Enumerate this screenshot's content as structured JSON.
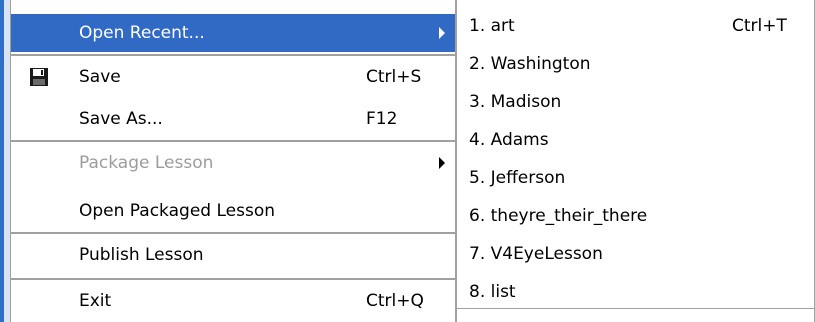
{
  "menu": {
    "open_recent": {
      "label": "Open Recent...",
      "shortcut": ""
    },
    "save": {
      "label": "Save",
      "shortcut": "Ctrl+S",
      "icon": "floppy-disk-icon"
    },
    "save_as": {
      "label": "Save As...",
      "shortcut": "F12"
    },
    "package_lesson": {
      "label": "Package Lesson",
      "shortcut": ""
    },
    "open_packaged_lesson": {
      "label": "Open Packaged Lesson",
      "shortcut": ""
    },
    "publish_lesson": {
      "label": "Publish Lesson",
      "shortcut": ""
    },
    "exit": {
      "label": "Exit",
      "shortcut": "Ctrl+Q"
    }
  },
  "submenu": {
    "items": [
      {
        "label": "1. art",
        "shortcut": "Ctrl+T"
      },
      {
        "label": "2. Washington",
        "shortcut": ""
      },
      {
        "label": "3. Madison",
        "shortcut": ""
      },
      {
        "label": "4. Adams",
        "shortcut": ""
      },
      {
        "label": "5. Jefferson",
        "shortcut": ""
      },
      {
        "label": "6. theyre_their_there",
        "shortcut": ""
      },
      {
        "label": "7. V4EyeLesson",
        "shortcut": ""
      },
      {
        "label": "8. list",
        "shortcut": ""
      }
    ]
  },
  "colors": {
    "highlight": "#316ac5",
    "disabled_text": "#9c9c9c",
    "separator": "#a0a0a0"
  }
}
